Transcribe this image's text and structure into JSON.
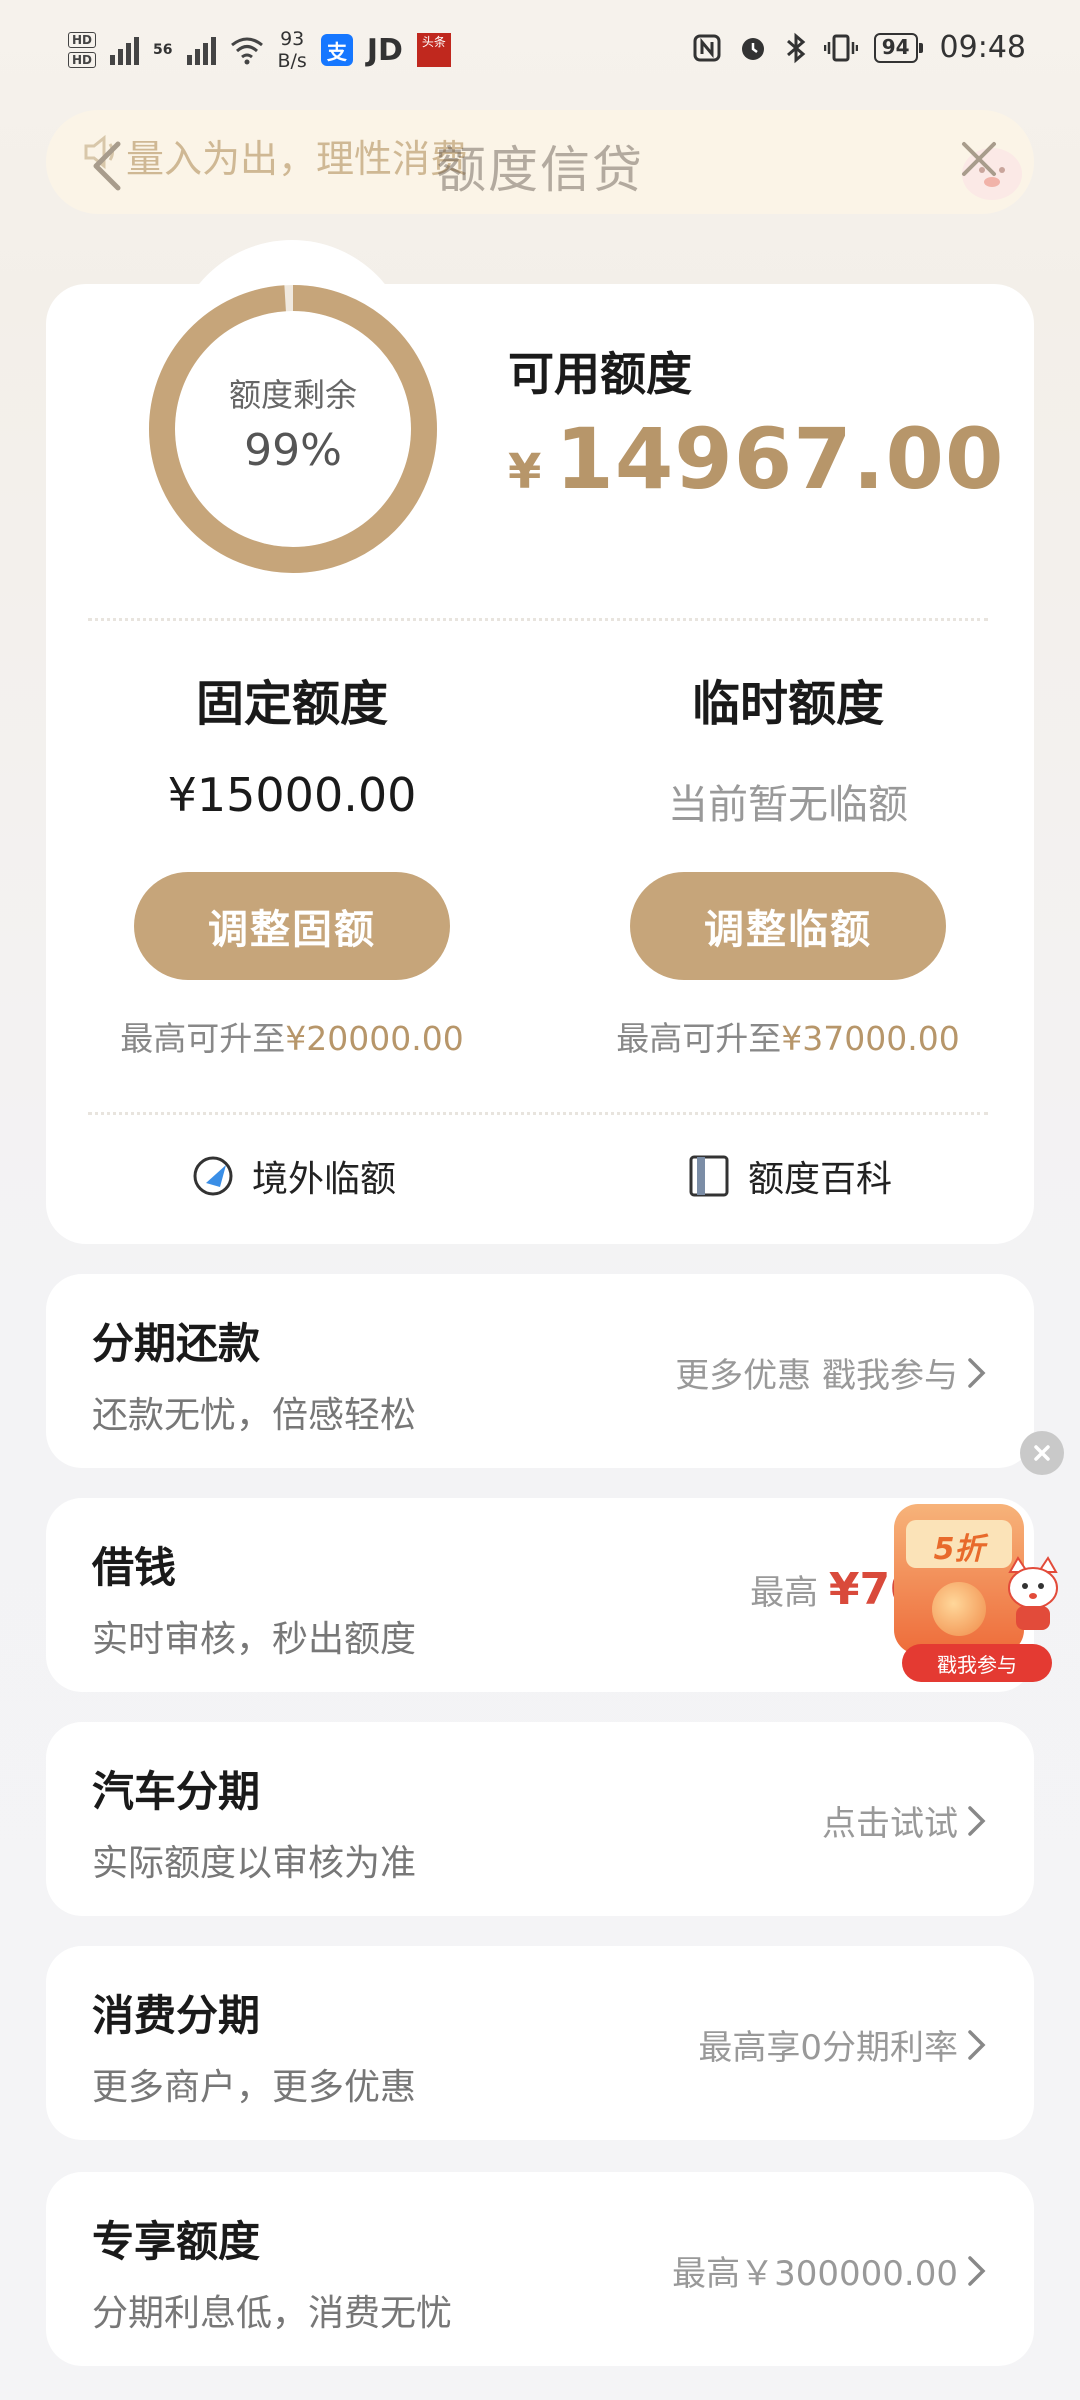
{
  "status_bar": {
    "network_speed_value": "93",
    "network_speed_unit": "B/s",
    "carrier_label": "56",
    "hd1": "HD",
    "hd2": "HD",
    "alipay_icon": "支",
    "jd_label": "JD",
    "news_icon": "头条",
    "battery": "94",
    "time": "09:48"
  },
  "header": {
    "notice": "量入为出，理性消费",
    "title": "额度信贷"
  },
  "credit": {
    "ring_label": "额度剩余",
    "ring_value": "99%",
    "ring_fraction": 0.99,
    "available_label": "可用额度",
    "available_currency": "¥",
    "available_amount": "14967.00",
    "fixed": {
      "title": "固定额度",
      "amount": "¥15000.00",
      "button": "调整固额",
      "note_prefix": "最高可升至",
      "note_amount": "¥20000.00"
    },
    "temp": {
      "title": "临时额度",
      "status": "当前暂无临额",
      "button": "调整临额",
      "note_prefix": "最高可升至",
      "note_amount": "¥37000.00"
    },
    "links": [
      {
        "label": "境外临额",
        "icon": "plane-globe-icon"
      },
      {
        "label": "额度百科",
        "icon": "book-icon"
      }
    ]
  },
  "list": [
    {
      "title": "分期还款",
      "subtitle": "还款无忧，倍感轻松",
      "right": "更多优惠 戳我参与"
    },
    {
      "title": "借钱",
      "subtitle": "实时审核，秒出额度",
      "right_prefix": "最高 ",
      "right_amount": "¥7000"
    },
    {
      "title": "汽车分期",
      "subtitle": "实际额度以审核为准",
      "right": "点击试试"
    },
    {
      "title": "消费分期",
      "subtitle": "更多商户，更多优惠",
      "right": "最高享0分期利率"
    },
    {
      "title": "专享额度",
      "subtitle": "分期利息低，消费无忧",
      "right": "最高￥300000.00"
    }
  ],
  "promo": {
    "discount": "5折",
    "button": "戳我参与"
  },
  "colors": {
    "gold": "#b7966a",
    "button_gold": "#c6a57a",
    "red": "#d94a3b"
  }
}
